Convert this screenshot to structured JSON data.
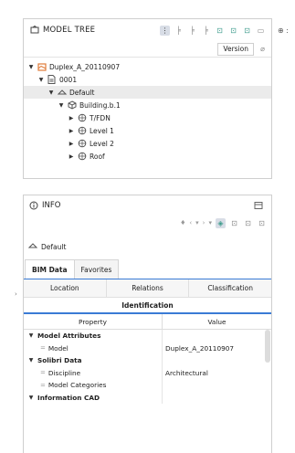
{
  "model_tree": {
    "title": "MODEL TREE",
    "header_icons": [
      "hierarchy-icon",
      "tree-icon",
      "tree-alt-icon",
      "tree-filter-icon",
      "layers-icon",
      "lock-icon",
      "lock-closed-icon",
      "collapse-icon"
    ],
    "version_button": "Version",
    "rows": [
      {
        "label": "Duplex_A_20110907",
        "depth": 0,
        "expanded": true,
        "icon": "model-icon",
        "selected": false
      },
      {
        "label": "0001",
        "depth": 1,
        "expanded": true,
        "icon": "document-icon",
        "selected": false
      },
      {
        "label": "Default",
        "depth": 2,
        "expanded": true,
        "icon": "site-icon",
        "selected": true
      },
      {
        "label": "Building.b.1",
        "depth": 3,
        "expanded": true,
        "icon": "building-icon",
        "selected": false
      },
      {
        "label": "T/FDN",
        "depth": 4,
        "expanded": false,
        "icon": "storey-icon",
        "selected": false
      },
      {
        "label": "Level 1",
        "depth": 4,
        "expanded": false,
        "icon": "storey-icon",
        "selected": false
      },
      {
        "label": "Level 2",
        "depth": 4,
        "expanded": false,
        "icon": "storey-icon",
        "selected": false
      },
      {
        "label": "Roof",
        "depth": 4,
        "expanded": false,
        "icon": "storey-icon",
        "selected": false
      }
    ]
  },
  "info": {
    "title": "INFO",
    "breadcrumb": "Default",
    "tabs": [
      "BIM Data",
      "Favorites"
    ],
    "subtabs": [
      "Location",
      "Relations",
      "Classification"
    ],
    "section": "Identification",
    "table_headers": [
      "Property",
      "Value"
    ],
    "rows": [
      {
        "type": "group",
        "name": "Model Attributes",
        "value": ""
      },
      {
        "type": "leaf",
        "name": "Model",
        "value": "Duplex_A_20110907"
      },
      {
        "type": "group",
        "name": "Solibri Data",
        "value": ""
      },
      {
        "type": "leaf",
        "name": "Discipline",
        "value": "Architectural"
      },
      {
        "type": "leaf",
        "name": "Model Categories",
        "value": ""
      },
      {
        "type": "group",
        "name": "Information CAD",
        "value": ""
      }
    ]
  },
  "colors": {
    "accent": "#3a7bd5",
    "teal": "#3a9a8a",
    "model_orange": "#e07b39",
    "selected_bg": "#ebebeb"
  }
}
